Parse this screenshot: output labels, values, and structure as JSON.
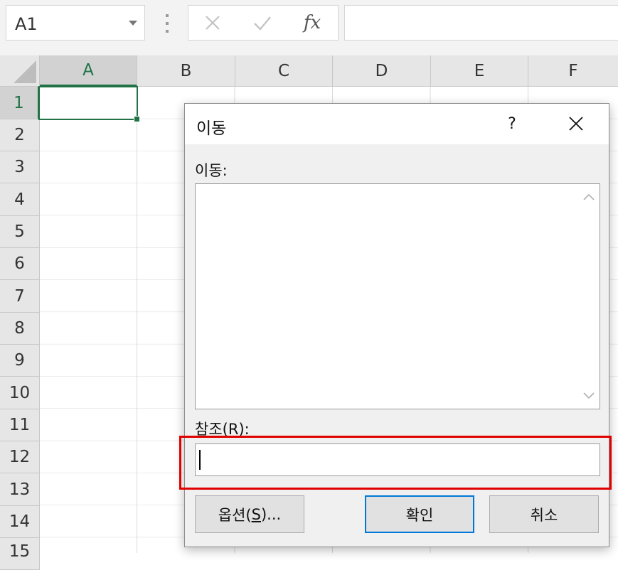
{
  "formula_bar": {
    "name_box": "A1",
    "fx_label": "fx",
    "formula": ""
  },
  "columns": [
    "A",
    "B",
    "C",
    "D",
    "E",
    "F"
  ],
  "rows": [
    "1",
    "2",
    "3",
    "4",
    "5",
    "6",
    "7",
    "8",
    "9",
    "10",
    "11",
    "12",
    "13",
    "14",
    "15"
  ],
  "selected_cell": "A1",
  "dialog": {
    "title": "이동",
    "help": "?",
    "goto_label": "이동:",
    "goto_items": [],
    "reference_label_prefix": "참조(",
    "reference_label_key": "R",
    "reference_label_suffix": "):",
    "reference_value": "",
    "options_prefix": "옵션(",
    "options_key": "S",
    "options_suffix": ")...",
    "ok_label": "확인",
    "cancel_label": "취소"
  },
  "colors": {
    "excel_green": "#217346",
    "highlight_red": "#e00000",
    "default_button_blue": "#0078d7"
  }
}
